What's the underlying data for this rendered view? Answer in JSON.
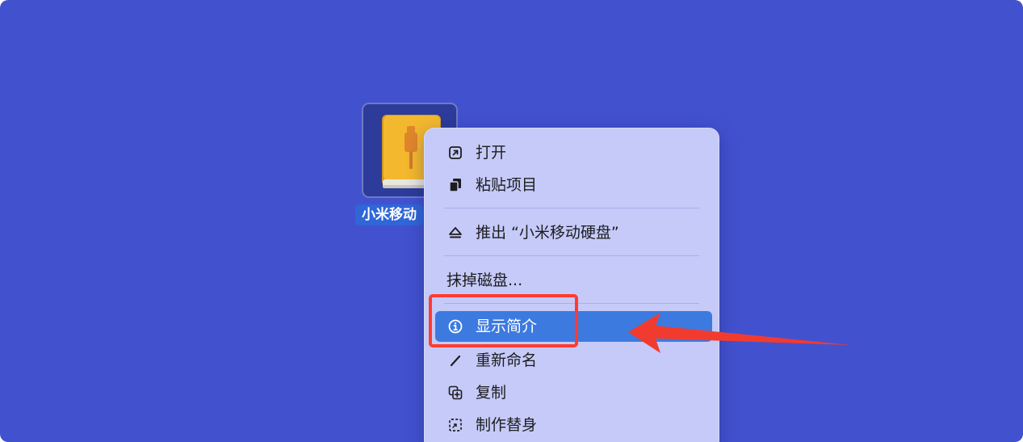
{
  "drive": {
    "icon": "usb-external-drive-icon",
    "label": "小米移动"
  },
  "context_menu": {
    "items": [
      {
        "label": "打开",
        "icon": "open-arrow-icon"
      },
      {
        "label": "粘贴项目",
        "icon": "paste-documents-icon"
      },
      {
        "label": "推出 “小米移动硬盘”",
        "icon": "eject-icon"
      },
      {
        "label": "抹掉磁盘...",
        "icon": ""
      },
      {
        "label": "显示简介",
        "icon": "info-circle-icon",
        "highlighted": true
      },
      {
        "label": "重新命名",
        "icon": "pencil-icon"
      },
      {
        "label": "复制",
        "icon": "duplicate-icon"
      },
      {
        "label": "制作替身",
        "icon": "alias-icon"
      }
    ]
  },
  "annotation": {
    "target": "显示简介",
    "color": "#ff3b30"
  },
  "colors": {
    "desktop_background": "#4252cf",
    "menu_background": "#c5caf8",
    "highlight": "#3c7ae0",
    "selection_label": "#2f66d8"
  }
}
